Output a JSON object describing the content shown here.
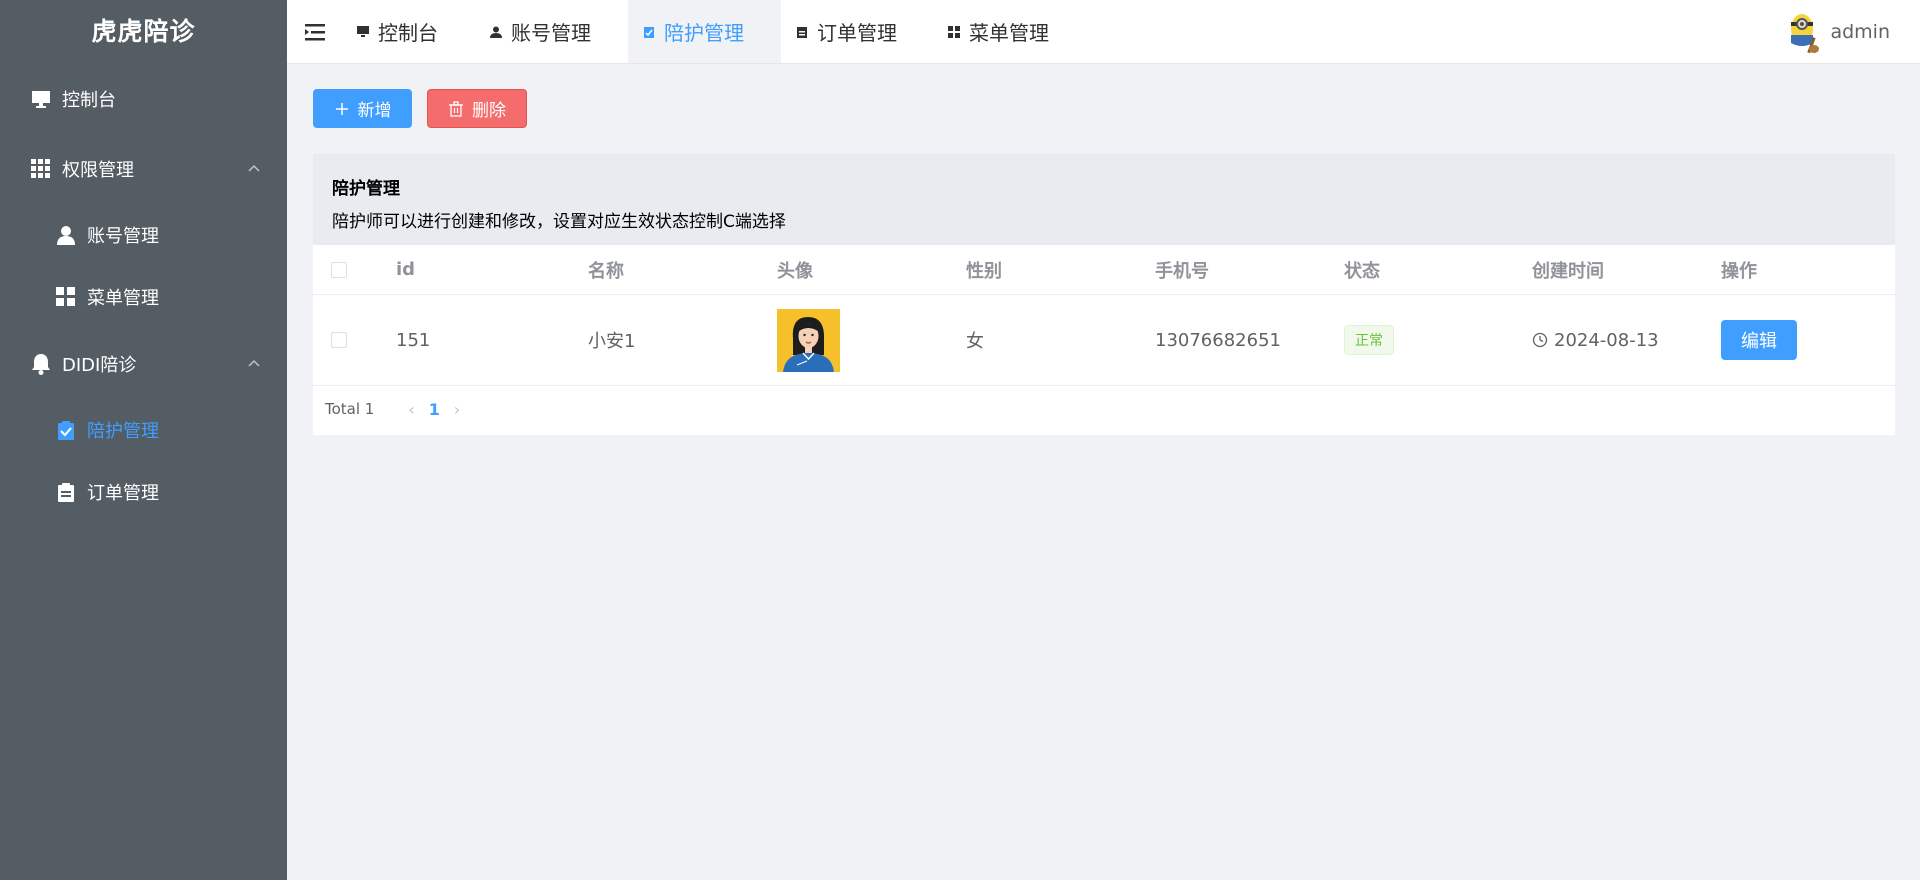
{
  "sidebar": {
    "brand": "虎虎陪诊",
    "items": [
      {
        "label": "控制台"
      },
      {
        "label": "权限管理"
      },
      {
        "label": "账号管理"
      },
      {
        "label": "菜单管理"
      },
      {
        "label": "DIDI陪诊"
      },
      {
        "label": "陪护管理"
      },
      {
        "label": "订单管理"
      }
    ]
  },
  "header": {
    "tabs": [
      {
        "label": "控制台"
      },
      {
        "label": "账号管理"
      },
      {
        "label": "陪护管理"
      },
      {
        "label": "订单管理"
      },
      {
        "label": "菜单管理"
      }
    ],
    "user": "admin"
  },
  "toolbar": {
    "add_label": "新增",
    "delete_label": "删除"
  },
  "panel": {
    "title": "陪护管理",
    "description": "陪护师可以进行创建和修改，设置对应生效状态控制C端选择"
  },
  "table": {
    "headers": [
      "id",
      "名称",
      "头像",
      "性别",
      "手机号",
      "状态",
      "创建时间",
      "操作"
    ],
    "rows": [
      {
        "id": "151",
        "name": "小安1",
        "gender": "女",
        "phone": "13076682651",
        "status": "正常",
        "created": "2024-08-13",
        "action": "编辑"
      }
    ]
  },
  "pagination": {
    "total": "Total 1",
    "page": "1"
  },
  "colors": {
    "sidebar_bg": "#545c64",
    "accent": "#409eff",
    "danger": "#f56c6c",
    "success": "#67c23a"
  }
}
